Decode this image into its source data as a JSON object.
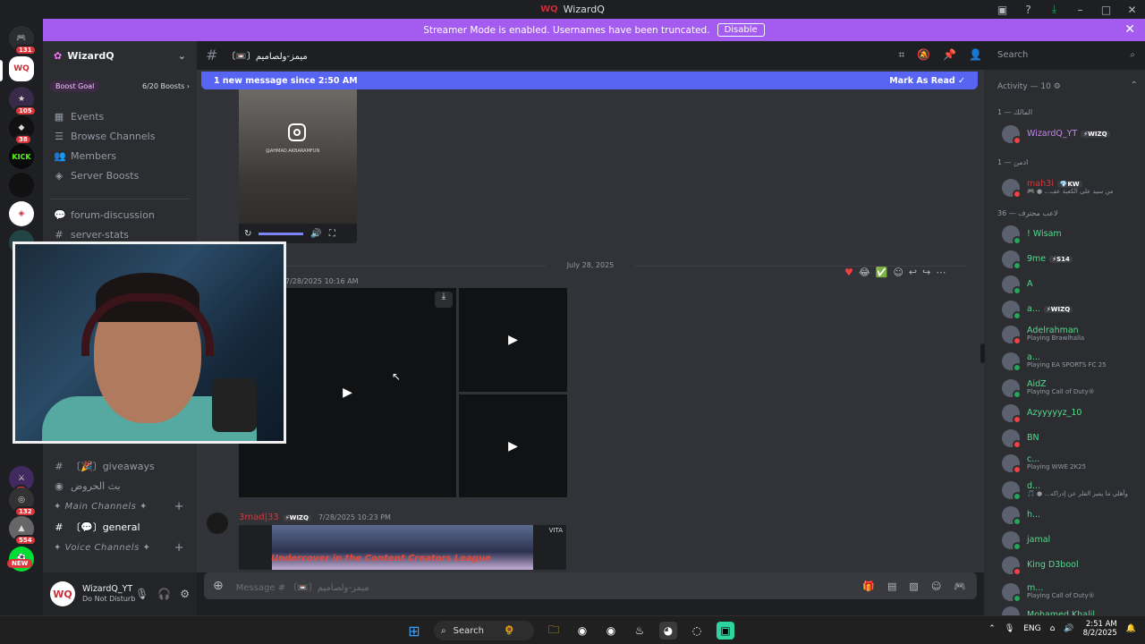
{
  "window": {
    "title": "WizardQ",
    "logo": "WQ"
  },
  "banner": {
    "text": "Streamer Mode is enabled. Usernames have been truncated.",
    "button": "Disable"
  },
  "rail": {
    "badges": [
      "131",
      "105",
      "38",
      "6",
      "132",
      "554"
    ],
    "kick": "KICK",
    "new": "NEW"
  },
  "guild": {
    "name": "WizardQ",
    "boost_goal": "Boost Goal",
    "boost_count": "6/20 Boosts"
  },
  "nav": {
    "events": "Events",
    "browse": "Browse Channels",
    "members": "Members",
    "server_boosts": "Server Boosts"
  },
  "channels": {
    "forum": "forum-discussion",
    "server_stats": "server-stats",
    "giveaways": "〔🎉〕giveaways",
    "stream_room": "بث الحروض",
    "cat_main": "✦ Main Channels ✦",
    "general": "〔💬〕general",
    "cat_voice": "✦ Voice Channels ✦"
  },
  "user": {
    "name": "WizardQ_YT",
    "status": "Do Not Disturb"
  },
  "chat": {
    "channel_name": "〔📼〕ميمز-ولصاميم",
    "search_placeholder": "Search",
    "new_messages": "1 new message since 2:50 AM",
    "mark_read": "Mark As Read",
    "instagram_handle": "@AHMAD.AKBARAMFUN",
    "date_sep": "July 28, 2025",
    "msg1_time": "7/28/2025 10:16 AM",
    "msg2_author": "3mad|33",
    "msg2_tag": "⚡WIZQ",
    "msg2_time": "7/28/2025 10:23 PM",
    "thumb_caption": "Undercover in the Content Creators League",
    "thumb_brand": "VITA",
    "composer_placeholder": "Message # 〔📼〕ميمز-ولصاميم"
  },
  "members": {
    "activity": "Activity — 10 ⚙",
    "group_owner": "المالك — 1",
    "group_admin": "ادمن — 1",
    "group_player": "لاعب محترف — 36",
    "list": [
      {
        "name": "WizardQ_YT",
        "tag": "⚡WIZQ",
        "sub": "",
        "color": "#c586f0",
        "status": "#f23f43"
      },
      {
        "name": "mah3i",
        "tag": "💎KW",
        "sub": "🎮 ● ...من سيد على الكعبة عف",
        "color": "#da373c",
        "status": "#f23f43"
      },
      {
        "name": "! Wisam",
        "tag": "",
        "sub": "",
        "color": "#57d98e",
        "status": "#23a55a"
      },
      {
        "name": "9me",
        "tag": "⚡S14",
        "sub": "",
        "color": "#57d98e",
        "status": "#23a55a"
      },
      {
        "name": "A",
        "tag": "",
        "sub": "",
        "color": "#57d98e",
        "status": "#23a55a"
      },
      {
        "name": "a...",
        "tag": "⚡WIZQ",
        "sub": "",
        "color": "#57d98e",
        "status": "#23a55a"
      },
      {
        "name": "Adelrahman",
        "tag": "",
        "sub": "Playing Brawlhalla",
        "color": "#57d98e",
        "status": "#f23f43"
      },
      {
        "name": "a...",
        "tag": "",
        "sub": "Playing EA SPORTS FC 25",
        "color": "#57d98e",
        "status": "#23a55a"
      },
      {
        "name": "AidZ",
        "tag": "",
        "sub": "Playing Call of Duty®",
        "color": "#57d98e",
        "status": "#23a55a"
      },
      {
        "name": "Azyyyyyz_10",
        "tag": "",
        "sub": "",
        "color": "#57d98e",
        "status": "#f23f43"
      },
      {
        "name": "BN",
        "tag": "",
        "sub": "",
        "color": "#57d98e",
        "status": "#f23f43"
      },
      {
        "name": "c...",
        "tag": "",
        "sub": "Playing WWE 2K25",
        "color": "#57d98e",
        "status": "#f23f43"
      },
      {
        "name": "d...",
        "tag": "",
        "sub": "🎵 ● ...وأهلي ما يميز الفلر عن إدراكه",
        "color": "#57d98e",
        "status": "#23a55a"
      },
      {
        "name": "h...",
        "tag": "",
        "sub": "",
        "color": "#57d98e",
        "status": "#23a55a"
      },
      {
        "name": "jamal",
        "tag": "",
        "sub": "",
        "color": "#57d98e",
        "status": "#23a55a"
      },
      {
        "name": "King D3bool",
        "tag": "",
        "sub": "",
        "color": "#57d98e",
        "status": "#f23f43"
      },
      {
        "name": "m...",
        "tag": "",
        "sub": "Playing Call of Duty®",
        "color": "#57d98e",
        "status": "#23a55a"
      },
      {
        "name": "Mohamed Khalil",
        "tag": "",
        "sub": "",
        "color": "#57d98e",
        "status": "#23a55a"
      }
    ]
  },
  "taskbar": {
    "search": "Search",
    "lang": "ENG",
    "time": "2:51 AM",
    "date": "8/2/2025"
  }
}
